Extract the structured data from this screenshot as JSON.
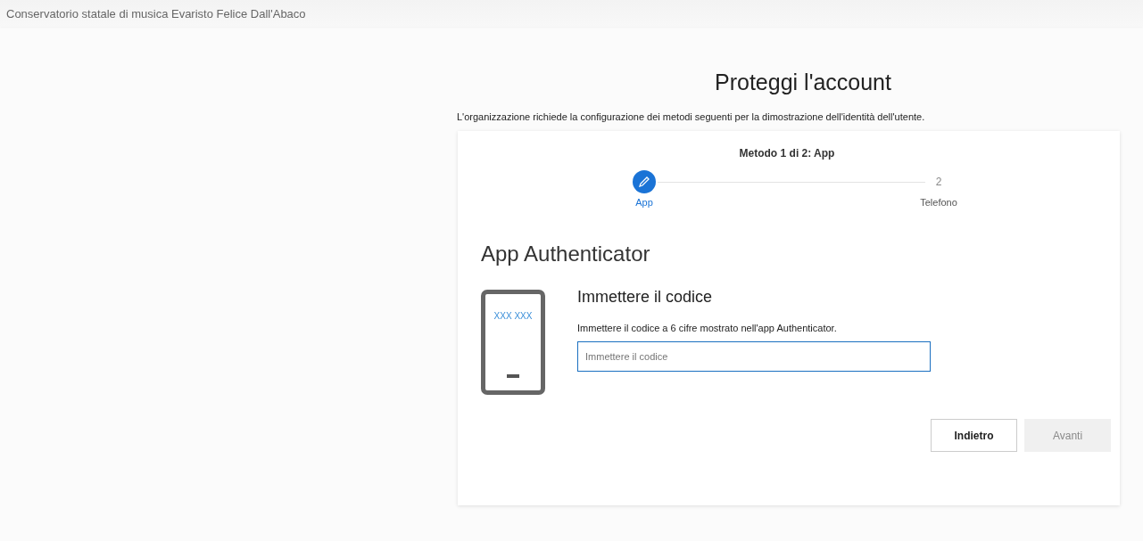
{
  "header": {
    "organization": "Conservatorio statale di musica Evaristo Felice Dall'Abaco"
  },
  "title": "Proteggi l'account",
  "subtitle": "L'organizzazione richiede la configurazione dei metodi seguenti per la dimostrazione dell'identità dell'utente.",
  "card": {
    "method_label": "Metodo 1 di 2: App",
    "steps": [
      {
        "kind": "icon",
        "label": "App",
        "selected": true
      },
      {
        "kind": "number",
        "number": "2",
        "label": "Telefono",
        "selected": false
      }
    ],
    "section_title": "App Authenticator",
    "phone_code": "XXX XXX",
    "heading": "Immettere il codice",
    "instruction": "Immettere il codice a 6 cifre mostrato nell'app Authenticator.",
    "code_field": {
      "placeholder": "Immettere il codice"
    },
    "buttons": [
      {
        "label": "Indietro",
        "disabled": false
      },
      {
        "label": "Avanti",
        "disabled": true
      }
    ]
  }
}
